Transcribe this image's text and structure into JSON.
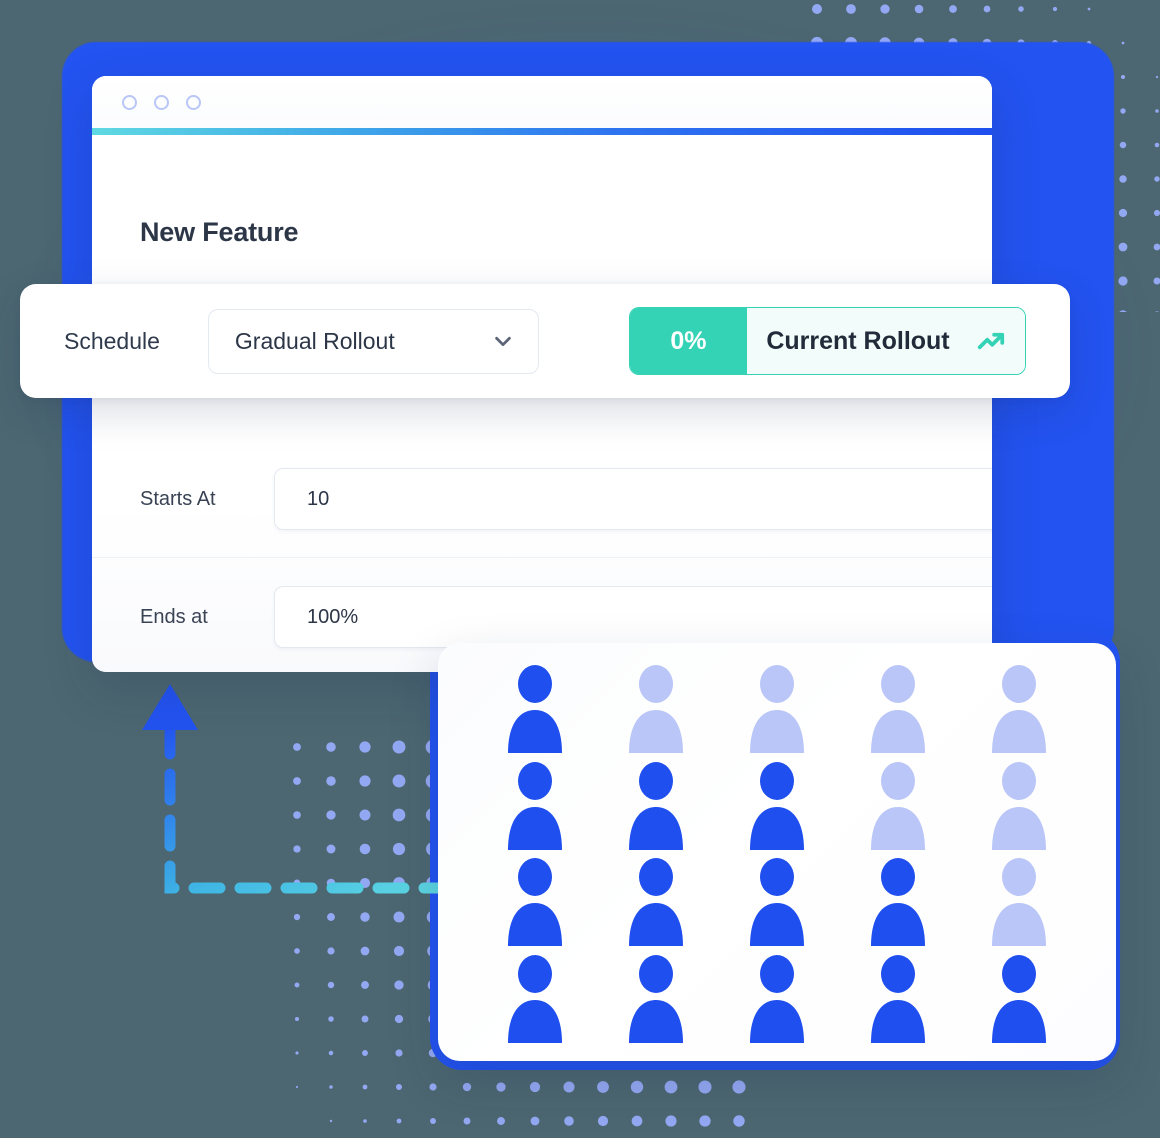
{
  "background": {
    "color": "#4C6771",
    "accent_blue": "#2353F0",
    "accent_cyan": "#5FD9E2",
    "accent_teal": "#34D3B6",
    "dot_color": "#93A8F2"
  },
  "browser": {
    "traffic_lights": [
      "window-dot-1",
      "window-dot-2",
      "window-dot-3"
    ],
    "accent_bar_from": "#5FD9E2",
    "accent_bar_to": "#1F4FEF",
    "page_title": "New Feature"
  },
  "schedule_card": {
    "label": "Schedule",
    "select": {
      "value": "Gradual Rollout",
      "placeholder": "Gradual Rollout",
      "chevron_icon": "chevron-down-icon",
      "options": [
        "Gradual Rollout"
      ]
    },
    "rollout_badge": {
      "percent": "0%",
      "label": "Current Rollout",
      "icon": "trending-up-icon",
      "fill_color": "#34D3B6",
      "body_color": "#F2FCFA"
    }
  },
  "form": {
    "rows": [
      {
        "label": "Starts At",
        "value": "10",
        "placeholder": "10"
      },
      {
        "label": "Ends at",
        "value": "100%",
        "placeholder": "100%"
      }
    ]
  },
  "people_card": {
    "colors": {
      "active": "#1F4FEF",
      "inactive": "#B9C6F7"
    },
    "rows": [
      [
        "active",
        "inactive",
        "inactive",
        "inactive",
        "inactive"
      ],
      [
        "active",
        "active",
        "active",
        "inactive",
        "inactive"
      ],
      [
        "active",
        "active",
        "active",
        "active",
        "inactive"
      ],
      [
        "active",
        "active",
        "active",
        "active",
        "active"
      ]
    ]
  },
  "decoration": {
    "arrow": {
      "name": "dashed-elbow-arrow",
      "direction": "up",
      "stroke_from": "#5FD9E2",
      "stroke_to": "#2353F0"
    }
  }
}
